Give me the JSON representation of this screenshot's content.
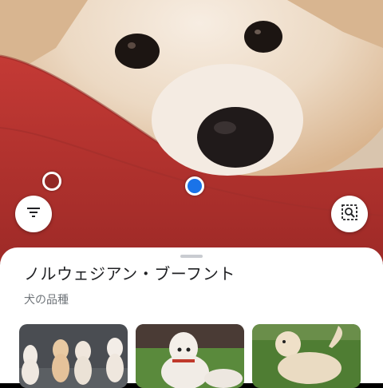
{
  "result": {
    "title": "ノルウェジアン・ブーフント",
    "subtitle": "犬の品種"
  },
  "icons": {
    "filter": "filter-icon",
    "lens": "lens-select-icon"
  },
  "colors": {
    "accent": "#1a73e8",
    "cushion": "#b7312e",
    "sheet": "#ffffff"
  },
  "thumbnails": [
    {
      "name": "group-of-white-dogs-image"
    },
    {
      "name": "white-dog-on-grass-image"
    },
    {
      "name": "cream-dog-standing-image"
    }
  ]
}
